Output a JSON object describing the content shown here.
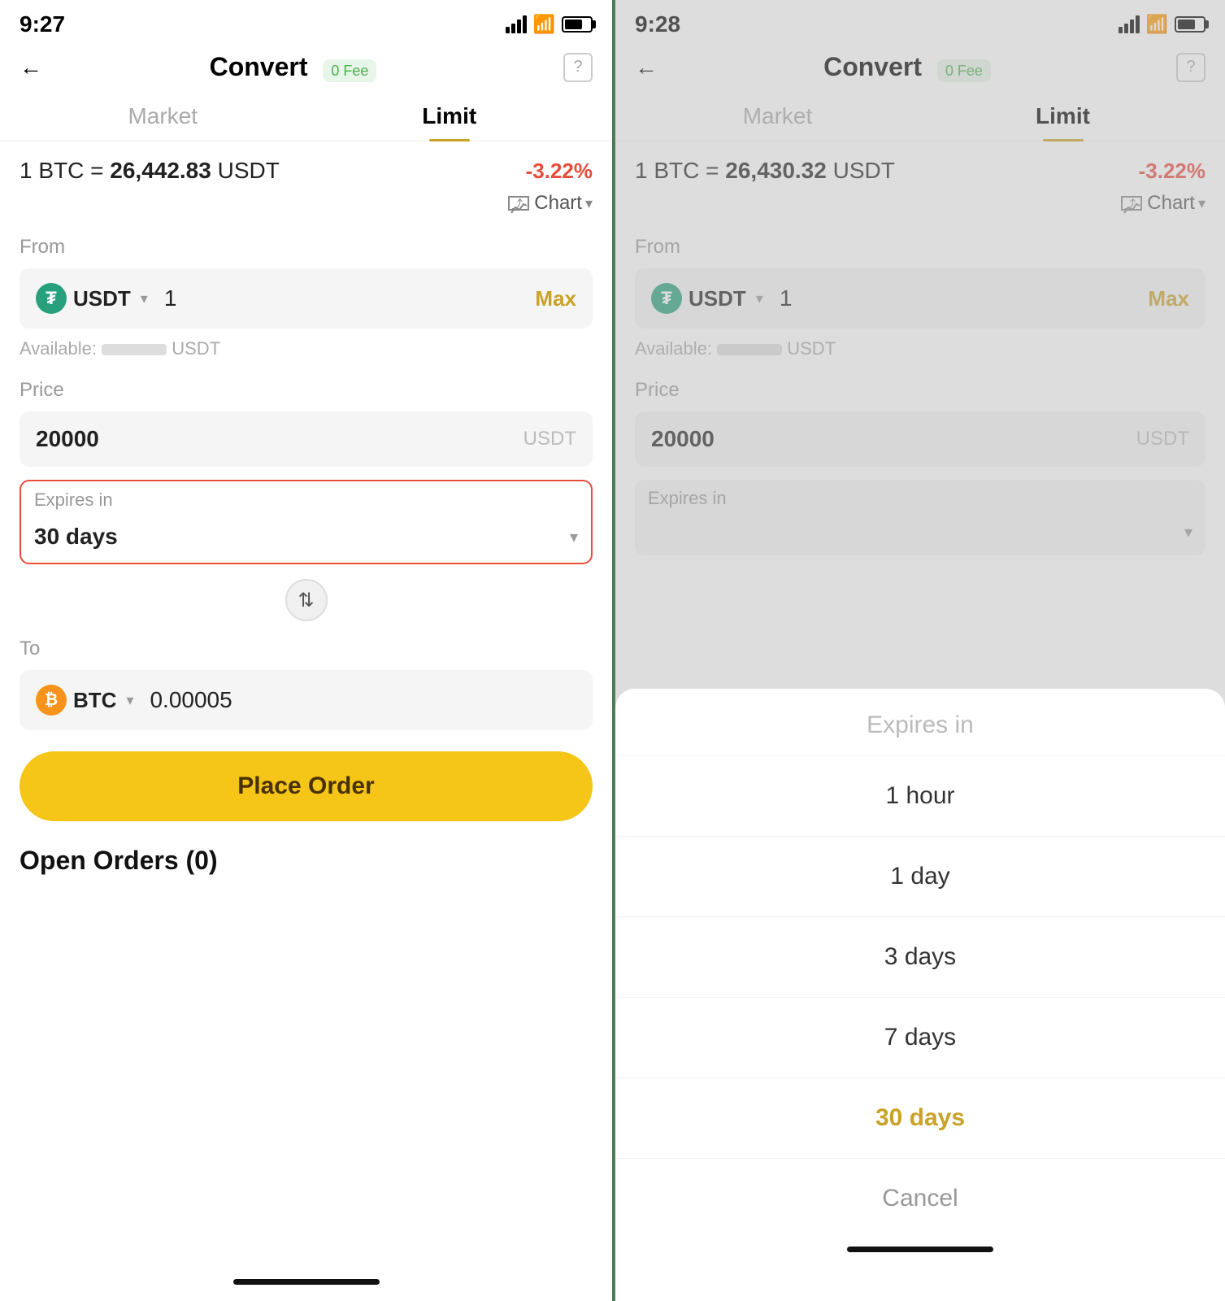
{
  "left_screen": {
    "status": {
      "time": "9:27"
    },
    "header": {
      "back_label": "←",
      "title": "Convert",
      "fee_badge": "0 Fee",
      "help_label": "?"
    },
    "tabs": {
      "market": "Market",
      "limit": "Limit"
    },
    "rate": {
      "prefix": "1 BTC =",
      "value": "26,442.83",
      "suffix": "USDT",
      "change": "-3.22%"
    },
    "chart_label": "Chart",
    "from_label": "From",
    "from_currency": "USDT",
    "from_amount": "1",
    "max_label": "Max",
    "available_label": "Available:",
    "available_suffix": "USDT",
    "price_label": "Price",
    "price_value": "20000",
    "price_unit": "USDT",
    "expires_label": "Expires in",
    "expires_value": "30 days",
    "to_label": "To",
    "to_currency": "BTC",
    "to_amount": "0.00005",
    "place_order_label": "Place Order",
    "open_orders_label": "Open Orders (0)"
  },
  "right_screen": {
    "status": {
      "time": "9:28"
    },
    "header": {
      "back_label": "←",
      "title": "Convert",
      "fee_badge": "0 Fee",
      "help_label": "?"
    },
    "tabs": {
      "market": "Market",
      "limit": "Limit"
    },
    "rate": {
      "prefix": "1 BTC =",
      "value": "26,430.32",
      "suffix": "USDT",
      "change": "-3.22%"
    },
    "chart_label": "Chart",
    "from_label": "From",
    "from_currency": "USDT",
    "from_amount": "1",
    "max_label": "Max",
    "available_label": "Available:",
    "available_suffix": "USDT",
    "price_label": "Price",
    "price_value": "20000",
    "price_unit": "USDT",
    "expires_label": "Expires in",
    "sheet": {
      "header": "Expires in",
      "options": [
        {
          "label": "1 hour",
          "selected": false
        },
        {
          "label": "1 day",
          "selected": false
        },
        {
          "label": "3 days",
          "selected": false
        },
        {
          "label": "7 days",
          "selected": false
        },
        {
          "label": "30 days",
          "selected": true
        },
        {
          "label": "Cancel",
          "cancel": true
        }
      ]
    }
  }
}
